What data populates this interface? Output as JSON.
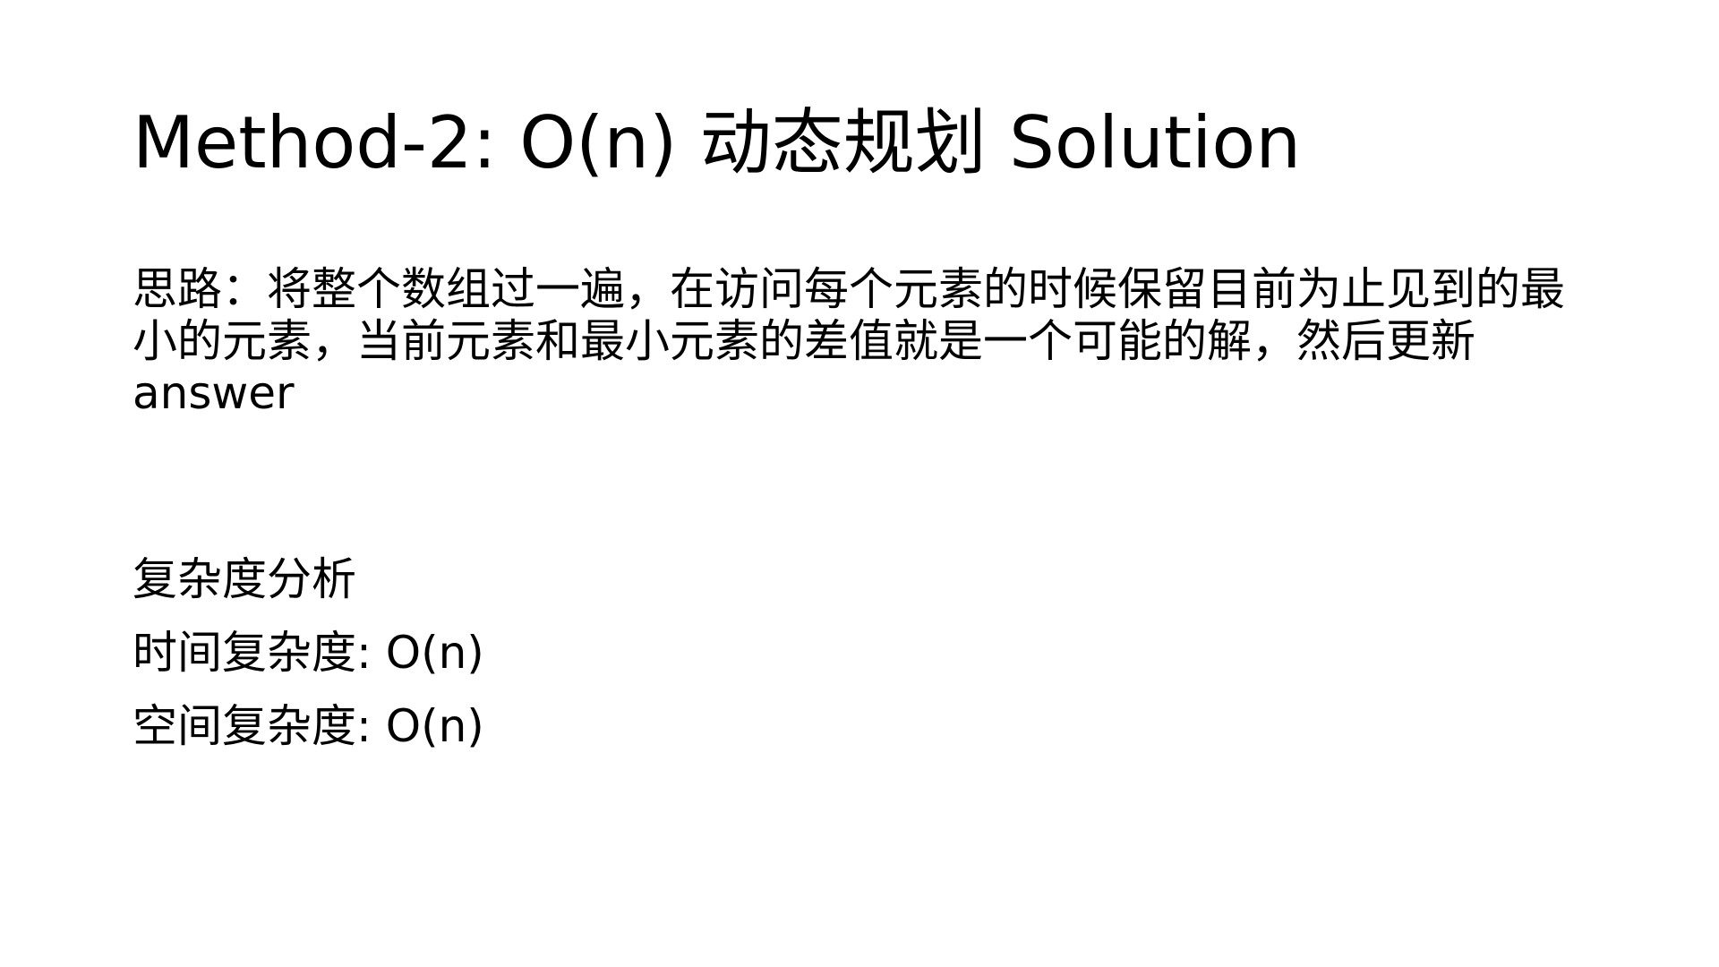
{
  "slide": {
    "title": "Method-2: O(n) 动态规划 Solution",
    "idea": "思路：将整个数组过一遍，在访问每个元素的时候保留目前为止见到的最小的元素，当前元素和最小元素的差值就是一个可能的解，然后更新answer",
    "complexity_heading": "复杂度分析",
    "time_complexity": "时间复杂度: O(n)",
    "space_complexity": "空间复杂度: O(n)"
  }
}
